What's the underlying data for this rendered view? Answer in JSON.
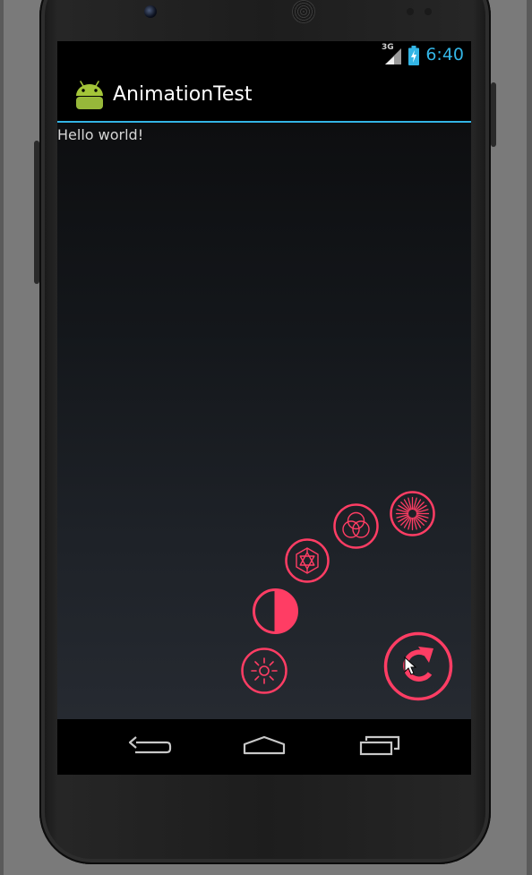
{
  "status_bar": {
    "time": "6:40",
    "network_type": "3G",
    "accent_color": "#33b5e5"
  },
  "action_bar": {
    "title": "AnimationTest",
    "icon": "android-icon"
  },
  "content": {
    "text": "Hello world!"
  },
  "menu": {
    "accent_color": "#ff3d64",
    "toggle_icon": "refresh-icon",
    "items": [
      {
        "icon": "sun-icon"
      },
      {
        "icon": "contrast-icon"
      },
      {
        "icon": "hexagram-icon"
      },
      {
        "icon": "venn-icon"
      },
      {
        "icon": "burst-icon"
      }
    ]
  },
  "nav_bar": {
    "buttons": [
      "back-icon",
      "home-icon",
      "recents-icon"
    ]
  }
}
